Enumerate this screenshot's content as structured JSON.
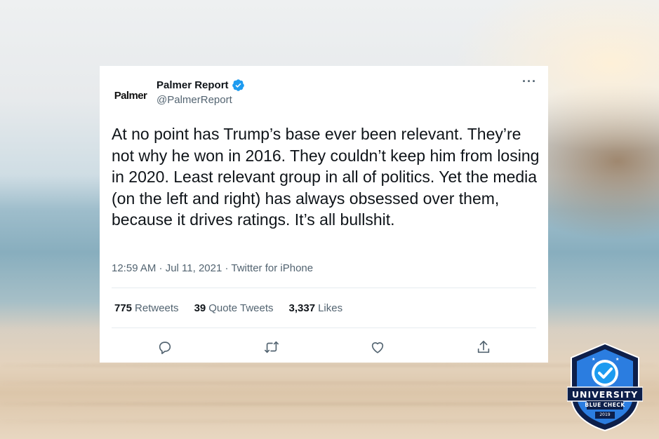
{
  "tweet": {
    "author_name": "Palmer Report",
    "handle": "@PalmerReport",
    "avatar_text": "Palmer",
    "text": "At no point has Trump’s base ever been relevant. They’re not why he won in 2016. They couldn’t keep him from losing in 2020. Least relevant group in all of politics. Yet the media (on the left and right) has always obsessed over them, because it drives ratings. It’s all bullshit.",
    "meta": "12:59 AM · Jul 11, 2021 · Twitter for iPhone",
    "more_label": "···",
    "stats": {
      "retweets_count": "775",
      "retweets_label": "Retweets",
      "quotes_count": "39",
      "quotes_label": "Quote Tweets",
      "likes_count": "3,337",
      "likes_label": "Likes"
    },
    "actions": [
      "reply-icon",
      "retweet-icon",
      "like-icon",
      "share-icon"
    ]
  },
  "badge": {
    "title": "UNIVERSITY",
    "subtitle": "BLUE CHECK",
    "year": "2019"
  },
  "colors": {
    "verified_blue": "#1d9bf0",
    "text_primary": "#0f1419",
    "text_secondary": "#536471",
    "badge_navy": "#0d1f4a",
    "badge_blue": "#2b7de0"
  }
}
